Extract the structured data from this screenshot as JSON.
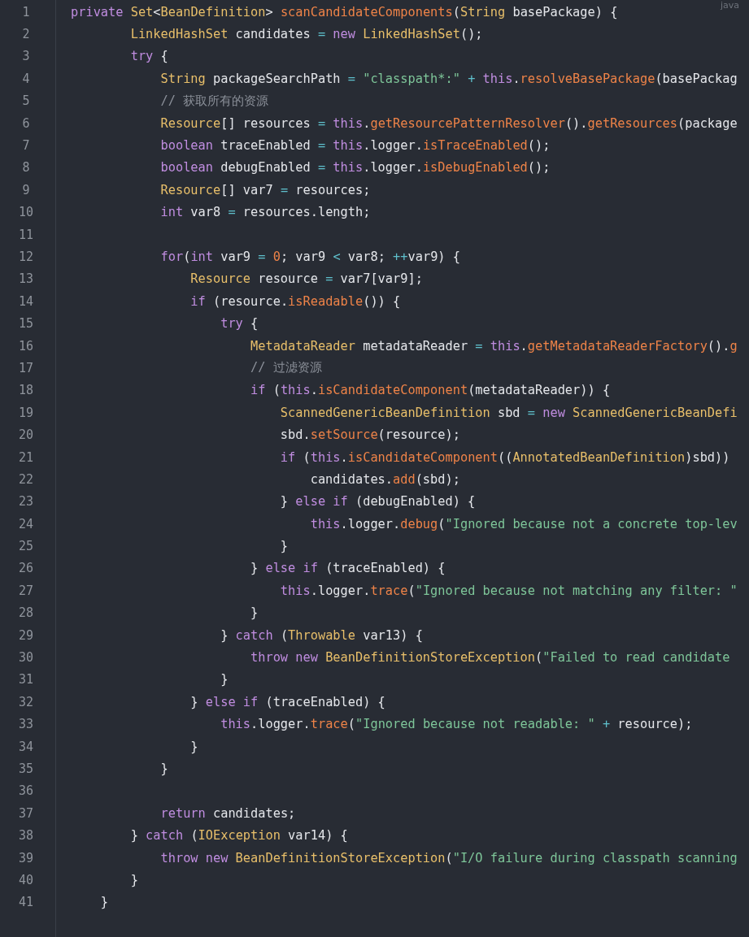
{
  "editor": {
    "language": "java",
    "lines": [
      {
        "number": "1",
        "tokens": [
          {
            "kind": "k",
            "text": "private "
          },
          {
            "kind": "t",
            "text": "Set"
          },
          {
            "kind": "p",
            "text": "<"
          },
          {
            "kind": "t",
            "text": "BeanDefinition"
          },
          {
            "kind": "p",
            "text": "> "
          },
          {
            "kind": "f",
            "text": "scanCandidateComponents"
          },
          {
            "kind": "p",
            "text": "("
          },
          {
            "kind": "t",
            "text": "String"
          },
          {
            "kind": "p",
            "text": " basePackage) {"
          }
        ]
      },
      {
        "number": "2",
        "tokens": [
          {
            "kind": "t",
            "text": "        LinkedHashSet"
          },
          {
            "kind": "p",
            "text": " candidates "
          },
          {
            "kind": "o",
            "text": "= "
          },
          {
            "kind": "k",
            "text": "new "
          },
          {
            "kind": "t",
            "text": "LinkedHashSet"
          },
          {
            "kind": "p",
            "text": "();"
          }
        ]
      },
      {
        "number": "3",
        "tokens": [
          {
            "kind": "k",
            "text": "        try"
          },
          {
            "kind": "p",
            "text": " {"
          }
        ]
      },
      {
        "number": "4",
        "tokens": [
          {
            "kind": "t",
            "text": "            String"
          },
          {
            "kind": "p",
            "text": " packageSearchPath "
          },
          {
            "kind": "o",
            "text": "= "
          },
          {
            "kind": "s",
            "text": "\"classpath*:\" "
          },
          {
            "kind": "o",
            "text": "+ "
          },
          {
            "kind": "k",
            "text": "this"
          },
          {
            "kind": "p",
            "text": "."
          },
          {
            "kind": "f",
            "text": "resolveBasePackage"
          },
          {
            "kind": "p",
            "text": "(basePackag"
          }
        ]
      },
      {
        "number": "5",
        "tokens": [
          {
            "kind": "c",
            "text": "            // 获取所有的资源"
          }
        ]
      },
      {
        "number": "6",
        "tokens": [
          {
            "kind": "t",
            "text": "            Resource"
          },
          {
            "kind": "p",
            "text": "[] resources "
          },
          {
            "kind": "o",
            "text": "= "
          },
          {
            "kind": "k",
            "text": "this"
          },
          {
            "kind": "p",
            "text": "."
          },
          {
            "kind": "f",
            "text": "getResourcePatternResolver"
          },
          {
            "kind": "p",
            "text": "()."
          },
          {
            "kind": "f",
            "text": "getResources"
          },
          {
            "kind": "p",
            "text": "(package"
          }
        ]
      },
      {
        "number": "7",
        "tokens": [
          {
            "kind": "k",
            "text": "            boolean"
          },
          {
            "kind": "p",
            "text": " traceEnabled "
          },
          {
            "kind": "o",
            "text": "= "
          },
          {
            "kind": "k",
            "text": "this"
          },
          {
            "kind": "p",
            "text": ".logger."
          },
          {
            "kind": "f",
            "text": "isTraceEnabled"
          },
          {
            "kind": "p",
            "text": "();"
          }
        ]
      },
      {
        "number": "8",
        "tokens": [
          {
            "kind": "k",
            "text": "            boolean"
          },
          {
            "kind": "p",
            "text": " debugEnabled "
          },
          {
            "kind": "o",
            "text": "= "
          },
          {
            "kind": "k",
            "text": "this"
          },
          {
            "kind": "p",
            "text": ".logger."
          },
          {
            "kind": "f",
            "text": "isDebugEnabled"
          },
          {
            "kind": "p",
            "text": "();"
          }
        ]
      },
      {
        "number": "9",
        "tokens": [
          {
            "kind": "t",
            "text": "            Resource"
          },
          {
            "kind": "p",
            "text": "[] var7 "
          },
          {
            "kind": "o",
            "text": "="
          },
          {
            "kind": "p",
            "text": " resources;"
          }
        ]
      },
      {
        "number": "10",
        "tokens": [
          {
            "kind": "k",
            "text": "            int"
          },
          {
            "kind": "p",
            "text": " var8 "
          },
          {
            "kind": "o",
            "text": "="
          },
          {
            "kind": "p",
            "text": " resources.length;"
          }
        ]
      },
      {
        "number": "11"
      },
      {
        "number": "12",
        "tokens": [
          {
            "kind": "k",
            "text": "            for"
          },
          {
            "kind": "p",
            "text": "("
          },
          {
            "kind": "k",
            "text": "int"
          },
          {
            "kind": "p",
            "text": " var9 "
          },
          {
            "kind": "o",
            "text": "= "
          },
          {
            "kind": "n",
            "text": "0"
          },
          {
            "kind": "p",
            "text": "; var9 "
          },
          {
            "kind": "o",
            "text": "<"
          },
          {
            "kind": "p",
            "text": " var8; "
          },
          {
            "kind": "o",
            "text": "++"
          },
          {
            "kind": "p",
            "text": "var9) {"
          }
        ]
      },
      {
        "number": "13",
        "tokens": [
          {
            "kind": "t",
            "text": "                Resource"
          },
          {
            "kind": "p",
            "text": " resource "
          },
          {
            "kind": "o",
            "text": "="
          },
          {
            "kind": "p",
            "text": " var7[var9];"
          }
        ]
      },
      {
        "number": "14",
        "tokens": [
          {
            "kind": "k",
            "text": "                if"
          },
          {
            "kind": "p",
            "text": " (resource."
          },
          {
            "kind": "f",
            "text": "isReadable"
          },
          {
            "kind": "p",
            "text": "()) {"
          }
        ]
      },
      {
        "number": "15",
        "tokens": [
          {
            "kind": "k",
            "text": "                    try"
          },
          {
            "kind": "p",
            "text": " {"
          }
        ]
      },
      {
        "number": "16",
        "tokens": [
          {
            "kind": "t",
            "text": "                        MetadataReader"
          },
          {
            "kind": "p",
            "text": " metadataReader "
          },
          {
            "kind": "o",
            "text": "= "
          },
          {
            "kind": "k",
            "text": "this"
          },
          {
            "kind": "p",
            "text": "."
          },
          {
            "kind": "f",
            "text": "getMetadataReaderFactory"
          },
          {
            "kind": "p",
            "text": "()."
          },
          {
            "kind": "f",
            "text": "g"
          }
        ]
      },
      {
        "number": "17",
        "tokens": [
          {
            "kind": "c",
            "text": "                        // 过滤资源"
          }
        ]
      },
      {
        "number": "18",
        "tokens": [
          {
            "kind": "k",
            "text": "                        if"
          },
          {
            "kind": "p",
            "text": " ("
          },
          {
            "kind": "k",
            "text": "this"
          },
          {
            "kind": "p",
            "text": "."
          },
          {
            "kind": "f",
            "text": "isCandidateComponent"
          },
          {
            "kind": "p",
            "text": "(metadataReader)) {"
          }
        ]
      },
      {
        "number": "19",
        "tokens": [
          {
            "kind": "t",
            "text": "                            ScannedGenericBeanDefinition"
          },
          {
            "kind": "p",
            "text": " sbd "
          },
          {
            "kind": "o",
            "text": "= "
          },
          {
            "kind": "k",
            "text": "new "
          },
          {
            "kind": "t",
            "text": "ScannedGenericBeanDefi"
          }
        ]
      },
      {
        "number": "20",
        "tokens": [
          {
            "kind": "p",
            "text": "                            sbd."
          },
          {
            "kind": "f",
            "text": "setSource"
          },
          {
            "kind": "p",
            "text": "(resource);"
          }
        ]
      },
      {
        "number": "21",
        "tokens": [
          {
            "kind": "k",
            "text": "                            if"
          },
          {
            "kind": "p",
            "text": " ("
          },
          {
            "kind": "k",
            "text": "this"
          },
          {
            "kind": "p",
            "text": "."
          },
          {
            "kind": "f",
            "text": "isCandidateComponent"
          },
          {
            "kind": "p",
            "text": "(("
          },
          {
            "kind": "t",
            "text": "AnnotatedBeanDefinition"
          },
          {
            "kind": "p",
            "text": ")sbd))"
          }
        ]
      },
      {
        "number": "22",
        "tokens": [
          {
            "kind": "p",
            "text": "                                candidates."
          },
          {
            "kind": "f",
            "text": "add"
          },
          {
            "kind": "p",
            "text": "(sbd);"
          }
        ]
      },
      {
        "number": "23",
        "tokens": [
          {
            "kind": "p",
            "text": "                            } "
          },
          {
            "kind": "k",
            "text": "else if"
          },
          {
            "kind": "p",
            "text": " (debugEnabled) {"
          }
        ]
      },
      {
        "number": "24",
        "tokens": [
          {
            "kind": "k",
            "text": "                                this"
          },
          {
            "kind": "p",
            "text": ".logger."
          },
          {
            "kind": "f",
            "text": "debug"
          },
          {
            "kind": "p",
            "text": "("
          },
          {
            "kind": "s",
            "text": "\"Ignored because not a concrete top-lev"
          }
        ]
      },
      {
        "number": "25",
        "tokens": [
          {
            "kind": "p",
            "text": "                            }"
          }
        ]
      },
      {
        "number": "26",
        "tokens": [
          {
            "kind": "p",
            "text": "                        } "
          },
          {
            "kind": "k",
            "text": "else if"
          },
          {
            "kind": "p",
            "text": " (traceEnabled) {"
          }
        ]
      },
      {
        "number": "27",
        "tokens": [
          {
            "kind": "k",
            "text": "                            this"
          },
          {
            "kind": "p",
            "text": ".logger."
          },
          {
            "kind": "f",
            "text": "trace"
          },
          {
            "kind": "p",
            "text": "("
          },
          {
            "kind": "s",
            "text": "\"Ignored because not matching any filter: \""
          }
        ]
      },
      {
        "number": "28",
        "tokens": [
          {
            "kind": "p",
            "text": "                        }"
          }
        ]
      },
      {
        "number": "29",
        "tokens": [
          {
            "kind": "p",
            "text": "                    } "
          },
          {
            "kind": "k",
            "text": "catch"
          },
          {
            "kind": "p",
            "text": " ("
          },
          {
            "kind": "t",
            "text": "Throwable"
          },
          {
            "kind": "p",
            "text": " var13) {"
          }
        ]
      },
      {
        "number": "30",
        "tokens": [
          {
            "kind": "k",
            "text": "                        throw new "
          },
          {
            "kind": "t",
            "text": "BeanDefinitionStoreException"
          },
          {
            "kind": "p",
            "text": "("
          },
          {
            "kind": "s",
            "text": "\"Failed to read candidate"
          }
        ]
      },
      {
        "number": "31",
        "tokens": [
          {
            "kind": "p",
            "text": "                    }"
          }
        ]
      },
      {
        "number": "32",
        "tokens": [
          {
            "kind": "p",
            "text": "                } "
          },
          {
            "kind": "k",
            "text": "else if"
          },
          {
            "kind": "p",
            "text": " (traceEnabled) {"
          }
        ]
      },
      {
        "number": "33",
        "tokens": [
          {
            "kind": "k",
            "text": "                    this"
          },
          {
            "kind": "p",
            "text": ".logger."
          },
          {
            "kind": "f",
            "text": "trace"
          },
          {
            "kind": "p",
            "text": "("
          },
          {
            "kind": "s",
            "text": "\"Ignored because not readable: \" "
          },
          {
            "kind": "o",
            "text": "+"
          },
          {
            "kind": "p",
            "text": " resource);"
          }
        ]
      },
      {
        "number": "34",
        "tokens": [
          {
            "kind": "p",
            "text": "                }"
          }
        ]
      },
      {
        "number": "35",
        "tokens": [
          {
            "kind": "p",
            "text": "            }"
          }
        ]
      },
      {
        "number": "36"
      },
      {
        "number": "37",
        "tokens": [
          {
            "kind": "k",
            "text": "            return"
          },
          {
            "kind": "p",
            "text": " candidates;"
          }
        ]
      },
      {
        "number": "38",
        "tokens": [
          {
            "kind": "p",
            "text": "        } "
          },
          {
            "kind": "k",
            "text": "catch"
          },
          {
            "kind": "p",
            "text": " ("
          },
          {
            "kind": "t",
            "text": "IOException"
          },
          {
            "kind": "p",
            "text": " var14) {"
          }
        ]
      },
      {
        "number": "39",
        "tokens": [
          {
            "kind": "k",
            "text": "            throw new "
          },
          {
            "kind": "t",
            "text": "BeanDefinitionStoreException"
          },
          {
            "kind": "p",
            "text": "("
          },
          {
            "kind": "s",
            "text": "\"I/O failure during classpath scanning"
          }
        ]
      },
      {
        "number": "40",
        "tokens": [
          {
            "kind": "p",
            "text": "        }"
          }
        ]
      },
      {
        "number": "41",
        "tokens": [
          {
            "kind": "p",
            "text": "    }"
          }
        ]
      }
    ]
  }
}
